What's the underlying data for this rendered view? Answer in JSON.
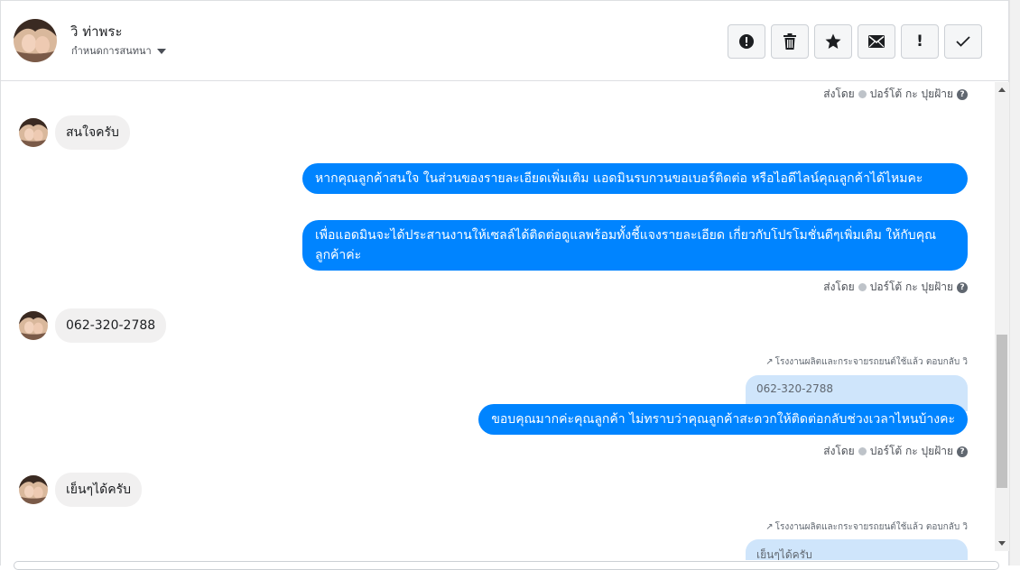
{
  "header": {
    "contact_name": "วิ ท่าพระ",
    "assign_label": "กำหนดการสนทนา",
    "toolbar": [
      {
        "name": "spam-alert",
        "icon": "alert-circle-icon"
      },
      {
        "name": "delete",
        "icon": "trash-icon"
      },
      {
        "name": "star",
        "icon": "star-icon"
      },
      {
        "name": "mark-unread",
        "icon": "envelope-icon"
      },
      {
        "name": "follow-up",
        "icon": "exclamation-icon",
        "glyph": "!"
      },
      {
        "name": "done",
        "icon": "check-icon"
      }
    ]
  },
  "thread": {
    "sent_by_prefix": "ส่งโดย",
    "sender_name": "ปอร์โต้ กะ ปุยฝ้าย",
    "incoming": [
      {
        "text": "สนใจครับ"
      },
      {
        "text": "062-320-2788"
      },
      {
        "text": "เย็นๆได้ครับ"
      }
    ],
    "outgoing": [
      {
        "text": "หากคุณลูกค้าสนใจ ในส่วนของรายละเอียดเพิ่มเติม แอดมินรบกวนขอเบอร์ติดต่อ หรือไอดีไลน์คุณลูกค้าได้ไหมคะ"
      },
      {
        "text": "เพื่อแอดมินจะได้ประสานงานให้เซลล์ได้ติดต่อดูแลพร้อมทั้งชี้แจงรายละเอียด เกี่ยวกับโปรโมชั่นดีๆเพิ่มเติม ให้กับคุณลูกค้าค่ะ"
      },
      {
        "text": "ขอบคุณมากค่ะคุณลูกค้า ไม่ทราบว่าคุณลูกค้าสะดวกให้ติดต่อกลับช่วงเวลาไหนบ้างคะ"
      }
    ],
    "reply_meta": "โรงงานผลิตและกระจายรถยนต์ใช้แล้ว ตอบกลับ วิ",
    "quoted": [
      {
        "text": "062-320-2788"
      },
      {
        "text": "เย็นๆได้ครับ"
      }
    ]
  },
  "colors": {
    "outgoing_bubble": "#0084ff",
    "incoming_bubble": "#f1f0f0",
    "quoted_bubble": "#cfe5fb"
  }
}
